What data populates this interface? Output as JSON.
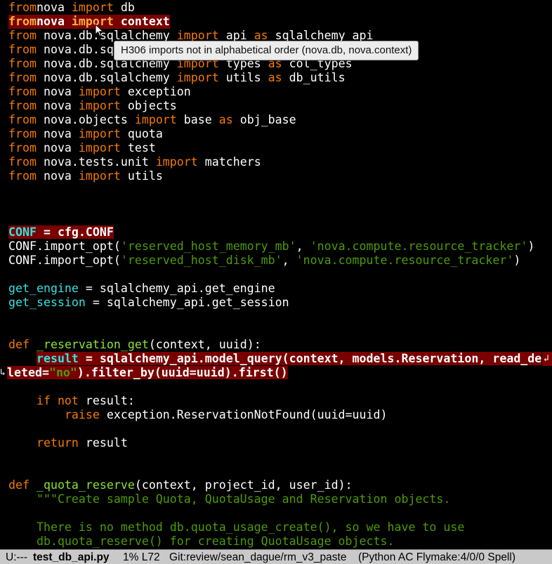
{
  "editor": {
    "lines": [
      {
        "row": 0,
        "segs": [
          [
            "kw",
            "from"
          ],
          [
            "",
            "nova "
          ],
          [
            "kw",
            "import"
          ],
          [
            "",
            " db"
          ]
        ]
      },
      {
        "row": 1,
        "highlight": true,
        "segs": [
          [
            "kw",
            "from"
          ],
          [
            "",
            ""
          ],
          [
            "",
            "nova "
          ],
          [
            "kw",
            "import"
          ],
          [
            "",
            " context"
          ]
        ]
      },
      {
        "row": 2,
        "segs": [
          [
            "kw",
            "from"
          ],
          [
            "",
            " nova.db.sqlalchemy "
          ],
          [
            "kw",
            "import"
          ],
          [
            "",
            " api "
          ],
          [
            "kw",
            "as"
          ],
          [
            "",
            " sqlalchemy_api"
          ]
        ]
      },
      {
        "row": 3,
        "segs": [
          [
            "kw",
            "from"
          ],
          [
            "",
            " nova.db.sqlalchemy "
          ],
          [
            "kw",
            "import"
          ],
          [
            "",
            " models"
          ]
        ]
      },
      {
        "row": 4,
        "segs": [
          [
            "kw",
            "from"
          ],
          [
            "",
            " nova.db.sqlalchemy "
          ],
          [
            "kw",
            "import"
          ],
          [
            "",
            " types "
          ],
          [
            "kw",
            "as"
          ],
          [
            "",
            " col_types"
          ]
        ]
      },
      {
        "row": 5,
        "segs": [
          [
            "kw",
            "from"
          ],
          [
            "",
            " nova.db.sqlalchemy "
          ],
          [
            "kw",
            "import"
          ],
          [
            "",
            " utils "
          ],
          [
            "kw",
            "as"
          ],
          [
            "",
            " db_utils"
          ]
        ]
      },
      {
        "row": 6,
        "segs": [
          [
            "kw",
            "from"
          ],
          [
            "",
            " nova "
          ],
          [
            "kw",
            "import"
          ],
          [
            "",
            " exception"
          ]
        ]
      },
      {
        "row": 7,
        "segs": [
          [
            "kw",
            "from"
          ],
          [
            "",
            " nova "
          ],
          [
            "kw",
            "import"
          ],
          [
            "",
            " objects"
          ]
        ]
      },
      {
        "row": 8,
        "segs": [
          [
            "kw",
            "from"
          ],
          [
            "",
            " nova.objects "
          ],
          [
            "kw",
            "import"
          ],
          [
            "",
            " base "
          ],
          [
            "kw",
            "as"
          ],
          [
            "",
            " obj_base"
          ]
        ]
      },
      {
        "row": 9,
        "segs": [
          [
            "kw",
            "from"
          ],
          [
            "",
            " nova "
          ],
          [
            "kw",
            "import"
          ],
          [
            "",
            " quota"
          ]
        ]
      },
      {
        "row": 10,
        "segs": [
          [
            "kw",
            "from"
          ],
          [
            "",
            " nova "
          ],
          [
            "kw",
            "import"
          ],
          [
            "",
            " test"
          ]
        ]
      },
      {
        "row": 11,
        "segs": [
          [
            "kw",
            "from"
          ],
          [
            "",
            " nova.tests.unit "
          ],
          [
            "kw",
            "import"
          ],
          [
            "",
            " matchers"
          ]
        ]
      },
      {
        "row": 12,
        "segs": [
          [
            "kw",
            "from"
          ],
          [
            "",
            " nova "
          ],
          [
            "kw",
            "import"
          ],
          [
            "",
            " utils"
          ]
        ]
      },
      {
        "row": 16,
        "highlight_partial": true,
        "segs": [
          [
            "var hl",
            "CONF"
          ],
          [
            "hl",
            " = cfg.CONF"
          ]
        ]
      },
      {
        "row": 17,
        "segs": [
          [
            "",
            "CONF.import_opt("
          ],
          [
            "str",
            "'reserved_host_memory_mb'"
          ],
          [
            "",
            ", "
          ],
          [
            "str",
            "'nova.compute.resource_tracker'"
          ],
          [
            "",
            ")"
          ]
        ]
      },
      {
        "row": 18,
        "segs": [
          [
            "",
            "CONF.import_opt("
          ],
          [
            "str",
            "'reserved_host_disk_mb'"
          ],
          [
            "",
            ", "
          ],
          [
            "str",
            "'nova.compute.resource_tracker'"
          ],
          [
            "",
            ")"
          ]
        ]
      },
      {
        "row": 20,
        "segs": [
          [
            "var",
            "get_engine"
          ],
          [
            "",
            " = sqlalchemy_api.get_engine"
          ]
        ]
      },
      {
        "row": 21,
        "segs": [
          [
            "var",
            "get_session"
          ],
          [
            "",
            " = sqlalchemy_api.get_session"
          ]
        ]
      },
      {
        "row": 24,
        "segs": [
          [
            "kw",
            "def"
          ],
          [
            "",
            " "
          ],
          [
            "def",
            "_reservation_get"
          ],
          [
            "",
            "(context, uuid):"
          ]
        ]
      },
      {
        "row": 25,
        "segs": [
          [
            "",
            "    "
          ],
          [
            "var hl",
            "result"
          ],
          [
            "hl",
            " = sqlalchemy_api.model_query(context, models.Reservation, read_de"
          ]
        ]
      },
      {
        "row": 26,
        "segs": [
          [
            "hl",
            "leted="
          ],
          [
            "str hl",
            "\"no\""
          ],
          [
            "hl",
            ").filter_by(uuid=uuid).first()"
          ]
        ]
      },
      {
        "row": 28,
        "segs": [
          [
            "",
            "    "
          ],
          [
            "kw",
            "if not"
          ],
          [
            "",
            " result:"
          ]
        ]
      },
      {
        "row": 29,
        "segs": [
          [
            "",
            "        "
          ],
          [
            "kw",
            "raise"
          ],
          [
            "",
            " exception.ReservationNotFound(uuid=uuid)"
          ]
        ]
      },
      {
        "row": 31,
        "segs": [
          [
            "",
            "    "
          ],
          [
            "kw",
            "return"
          ],
          [
            "",
            " result"
          ]
        ]
      },
      {
        "row": 34,
        "segs": [
          [
            "kw",
            "def"
          ],
          [
            "",
            " "
          ],
          [
            "def",
            "_quota_reserve"
          ],
          [
            "",
            "(context, project_id, user_id):"
          ]
        ]
      },
      {
        "row": 35,
        "segs": [
          [
            "",
            "    "
          ],
          [
            "doc",
            "\"\"\"Create sample Quota, QuotaUsage and Reservation objects."
          ]
        ]
      },
      {
        "row": 37,
        "segs": [
          [
            "",
            "    "
          ],
          [
            "doc",
            "There is no method db.quota_usage_create(), so we have to use"
          ]
        ]
      },
      {
        "row": 38,
        "segs": [
          [
            "",
            "    "
          ],
          [
            "doc",
            "db.quota_reserve() for creating QuotaUsage objects."
          ]
        ]
      }
    ]
  },
  "tooltip": {
    "text": "H306  imports not in alphabetical order (nova.db, nova.context)"
  },
  "modeline": {
    "state": "U:---",
    "filename": "test_db_api.py",
    "position": "1% L72",
    "git": "Git:review/sean_dague/rm_v3_paste",
    "modes": "(Python AC Flymake:4/0/0 Spell)"
  },
  "colors": {
    "background": "#000000",
    "keyword": "#f57900",
    "variable": "#34e2e2",
    "string": "#4e9a06",
    "function_name": "#8ae234",
    "error_highlight": "#7a0000",
    "modeline": "#c9c9c9"
  },
  "icons": {
    "mouse_cursor": "arrow-cursor-icon",
    "wrap_left": "line-wrap-arrow-icon",
    "wrap_right": "line-continuation-arrow-icon"
  }
}
